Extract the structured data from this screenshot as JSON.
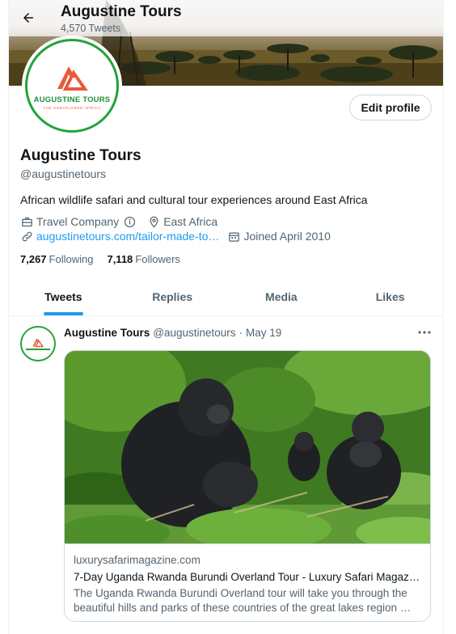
{
  "header": {
    "title": "Augustine Tours",
    "tweet_count": "4,570 Tweets"
  },
  "profile": {
    "logo_brand": "AUGUSTINE TOURS",
    "logo_tagline": "THE UNEXPLORED AFRICA",
    "name": "Augustine Tours",
    "handle": "@augustinetours",
    "bio": "African wildlife safari and cultural tour experiences around East Africa",
    "category": "Travel Company",
    "location": "East Africa",
    "website": "augustinetours.com/tailor-made-to…",
    "joined": "Joined April 2010",
    "edit_button": "Edit profile",
    "following_count": "7,267",
    "following_label": "Following",
    "followers_count": "7,118",
    "followers_label": "Followers"
  },
  "tabs": [
    {
      "label": "Tweets",
      "active": true
    },
    {
      "label": "Replies"
    },
    {
      "label": "Media"
    },
    {
      "label": "Likes"
    }
  ],
  "tweet": {
    "author": "Augustine Tours",
    "handle": "@augustinetours",
    "separator": "·",
    "date": "May 19",
    "card": {
      "domain": "luxurysafarimagazine.com",
      "title": "7-Day Uganda Rwanda Burundi Overland Tour - Luxury Safari Magaz…",
      "description": "The Uganda Rwanda Burundi Overland tour will take you through the beautiful hills and parks of these countries of the great lakes region …"
    }
  },
  "colors": {
    "accent": "#1d9bf0",
    "brand_green": "#22a33a",
    "brand_orange": "#e85a3a",
    "text_secondary": "#536471"
  },
  "icons": [
    "back-arrow-icon",
    "briefcase-icon",
    "info-icon",
    "location-pin-icon",
    "link-icon",
    "calendar-icon",
    "more-icon"
  ]
}
